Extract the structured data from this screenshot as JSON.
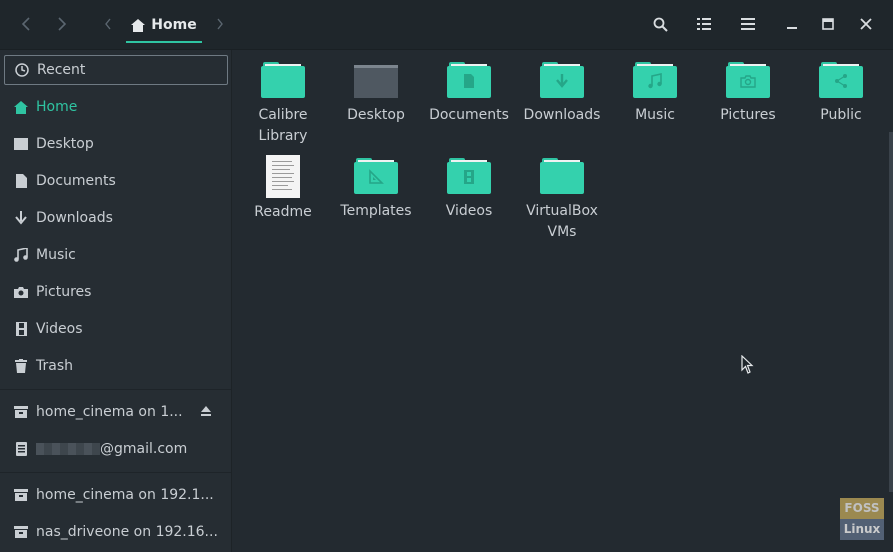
{
  "header": {
    "path_label": "Home",
    "icons": [
      "back-icon",
      "forward-icon",
      "path-left-icon",
      "home-icon",
      "path-right-icon",
      "search-icon",
      "list-view-icon",
      "menu-icon",
      "minimize-icon",
      "maximize-icon",
      "close-icon"
    ]
  },
  "sidebar": {
    "places": [
      {
        "label": "Recent",
        "icon": "clock-icon"
      },
      {
        "label": "Home",
        "icon": "home-icon"
      },
      {
        "label": "Desktop",
        "icon": "desktop-icon"
      },
      {
        "label": "Documents",
        "icon": "document-icon"
      },
      {
        "label": "Downloads",
        "icon": "download-icon"
      },
      {
        "label": "Music",
        "icon": "music-icon"
      },
      {
        "label": "Pictures",
        "icon": "camera-icon"
      },
      {
        "label": "Videos",
        "icon": "film-icon"
      },
      {
        "label": "Trash",
        "icon": "trash-icon"
      }
    ],
    "devices": [
      {
        "label": "home_cinema on 1...",
        "icon": "drive-icon"
      },
      {
        "label": "@gmail.com",
        "icon": "server-icon"
      }
    ],
    "network": [
      {
        "label": "home_cinema on 192.1...",
        "icon": "drive-icon"
      },
      {
        "label": "nas_driveone on 192.16...",
        "icon": "drive-icon"
      }
    ]
  },
  "files": [
    {
      "name": "Calibre Library",
      "line1": "Calibre",
      "line2": "Library",
      "type": "folder"
    },
    {
      "name": "Desktop",
      "line1": "Desktop",
      "line2": "",
      "type": "desktop"
    },
    {
      "name": "Documents",
      "line1": "Documents",
      "line2": "",
      "type": "folder-doc"
    },
    {
      "name": "Downloads",
      "line1": "Downloads",
      "line2": "",
      "type": "folder-down"
    },
    {
      "name": "Music",
      "line1": "Music",
      "line2": "",
      "type": "folder-music"
    },
    {
      "name": "Pictures",
      "line1": "Pictures",
      "line2": "",
      "type": "folder-camera"
    },
    {
      "name": "Public",
      "line1": "Public",
      "line2": "",
      "type": "folder-share"
    },
    {
      "name": "Readme",
      "line1": "Readme",
      "line2": "",
      "type": "document"
    },
    {
      "name": "Templates",
      "line1": "Templates",
      "line2": "",
      "type": "folder-template"
    },
    {
      "name": "Videos",
      "line1": "Videos",
      "line2": "",
      "type": "folder-film"
    },
    {
      "name": "VirtualBox VMs",
      "line1": "VirtualBox",
      "line2": "VMs",
      "type": "folder"
    }
  ],
  "watermark": {
    "line1": "FOSS",
    "line2": "Linux"
  },
  "colors": {
    "accent": "#2fc4a2",
    "folder": "#34d1ad",
    "background": "#232a30"
  }
}
